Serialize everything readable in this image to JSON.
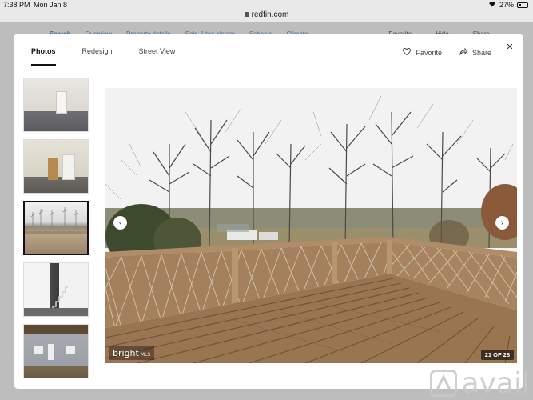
{
  "status_bar": {
    "time": "7:38 PM",
    "date": "Mon Jan 8",
    "battery": "27%",
    "battery_level": 0.27
  },
  "browser": {
    "url": "redfin.com"
  },
  "background_nav": {
    "items": [
      "Search",
      "Overview",
      "Property details",
      "Sale & tax history",
      "Schools",
      "Climate"
    ],
    "actions": [
      "Favorite",
      "Hide",
      "Share"
    ]
  },
  "modal": {
    "tabs": [
      "Photos",
      "Redesign",
      "Street View"
    ],
    "active_tab": "Photos",
    "favorite_label": "Favorite",
    "share_label": "Share",
    "close_glyph": "✕"
  },
  "thumbnails": [
    {
      "subject": "empty room with door",
      "selected": false
    },
    {
      "subject": "hallway",
      "selected": false
    },
    {
      "subject": "deck",
      "selected": true
    },
    {
      "subject": "staircase",
      "selected": false
    },
    {
      "subject": "basement exterior",
      "selected": false
    }
  ],
  "photo": {
    "mls_logo": "bright",
    "mls_suffix": "MLS",
    "counter": "21 OF 28",
    "prev_glyph": "‹",
    "next_glyph": "›"
  },
  "watermark": "avail",
  "colors": {
    "accent": "#3d6f9c",
    "deck": "#a88560",
    "sky": "#f2f2f2"
  }
}
